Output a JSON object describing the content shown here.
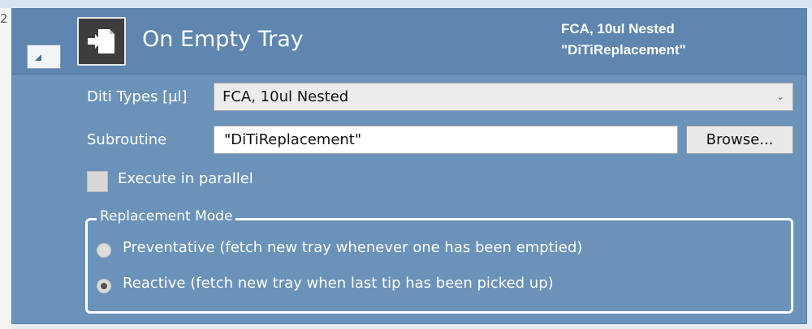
{
  "header": {
    "title": "On Empty Tray",
    "summary_line1": "FCA, 10ul Nested",
    "summary_line2": "\"DiTiReplacement\"",
    "icon": "tray-replace-icon"
  },
  "form": {
    "diti_types_label": "Diti Types [µl]",
    "diti_types_value": "FCA, 10ul Nested",
    "subroutine_label": "Subroutine",
    "subroutine_value": "\"DiTiReplacement\"",
    "browse_label": "Browse...",
    "execute_parallel_label": "Execute in parallel",
    "execute_parallel_checked": false
  },
  "replacement_mode": {
    "legend": "Replacement Mode",
    "options": [
      {
        "label": "Preventative (fetch new tray whenever one has been emptied)",
        "selected": false
      },
      {
        "label": "Reactive (fetch new tray when last tip has been picked up)",
        "selected": true
      }
    ]
  },
  "corner_mark": "2",
  "colors": {
    "panel": "#6b92b8",
    "header": "#5e86ae"
  }
}
